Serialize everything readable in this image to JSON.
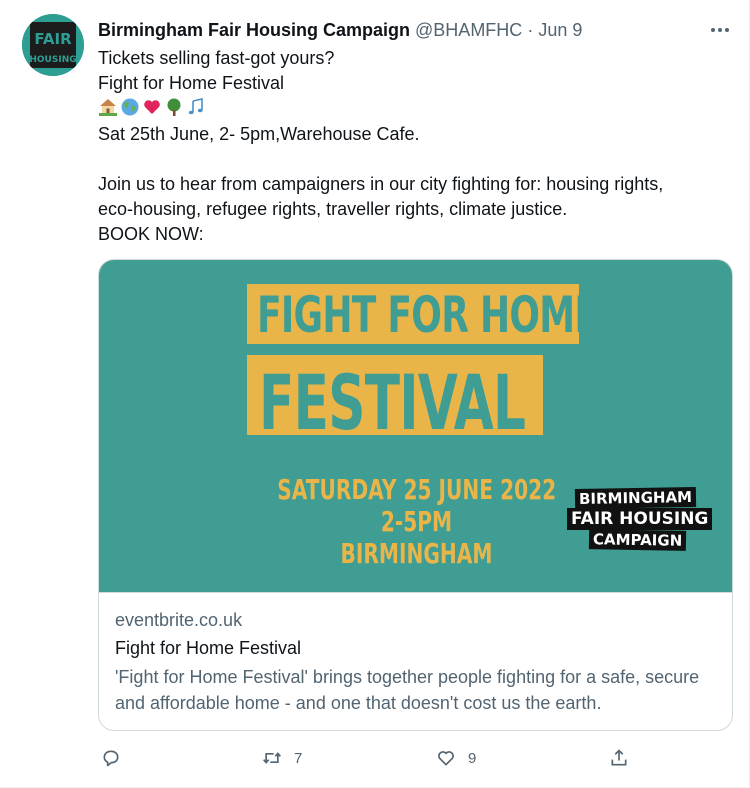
{
  "author": {
    "name": "Birmingham Fair Housing Campaign",
    "handle": "@BHAMFHC",
    "separator": "·",
    "date": "Jun 9"
  },
  "avatar": {
    "text_top": "FAIR",
    "text_bottom": "HOUSING",
    "color": "#2e9e93"
  },
  "tweet": {
    "line1": "Tickets selling fast-got yours?",
    "line2": "Fight for Home Festival",
    "emojis": [
      "house-with-garden-emoji",
      "globe-emoji",
      "red-heart-emoji",
      "deciduous-tree-emoji",
      "musical-notes-emoji"
    ],
    "line3": "Sat 25th June, 2- 5pm,Warehouse Cafe.",
    "line4": "Join us to hear from campaigners in our city fighting for: housing rights,",
    "line5": "eco-housing, refugee rights, traveller rights, climate justice.",
    "line6": "BOOK NOW:"
  },
  "card": {
    "image": {
      "headline1": "FIGHT FOR HOME",
      "headline2": "FESTIVAL",
      "date": "SATURDAY 25 JUNE 2022",
      "time": "2-5PM",
      "place": "BIRMINGHAM",
      "logo_line1": "BIRMINGHAM",
      "logo_line2": "FAIR HOUSING",
      "logo_line3": "CAMPAIGN",
      "bg_color": "#3f9d93",
      "accent_color": "#e9b549"
    },
    "domain": "eventbrite.co.uk",
    "title": "Fight for Home Festival",
    "description": "'Fight for Home Festival' brings together people fighting for a safe, secure and affordable home - and one that doesn't cost us the earth."
  },
  "actions": {
    "reply_icon": "reply-icon",
    "retweet_count": "7",
    "like_count": "9",
    "share_icon": "share-icon"
  }
}
